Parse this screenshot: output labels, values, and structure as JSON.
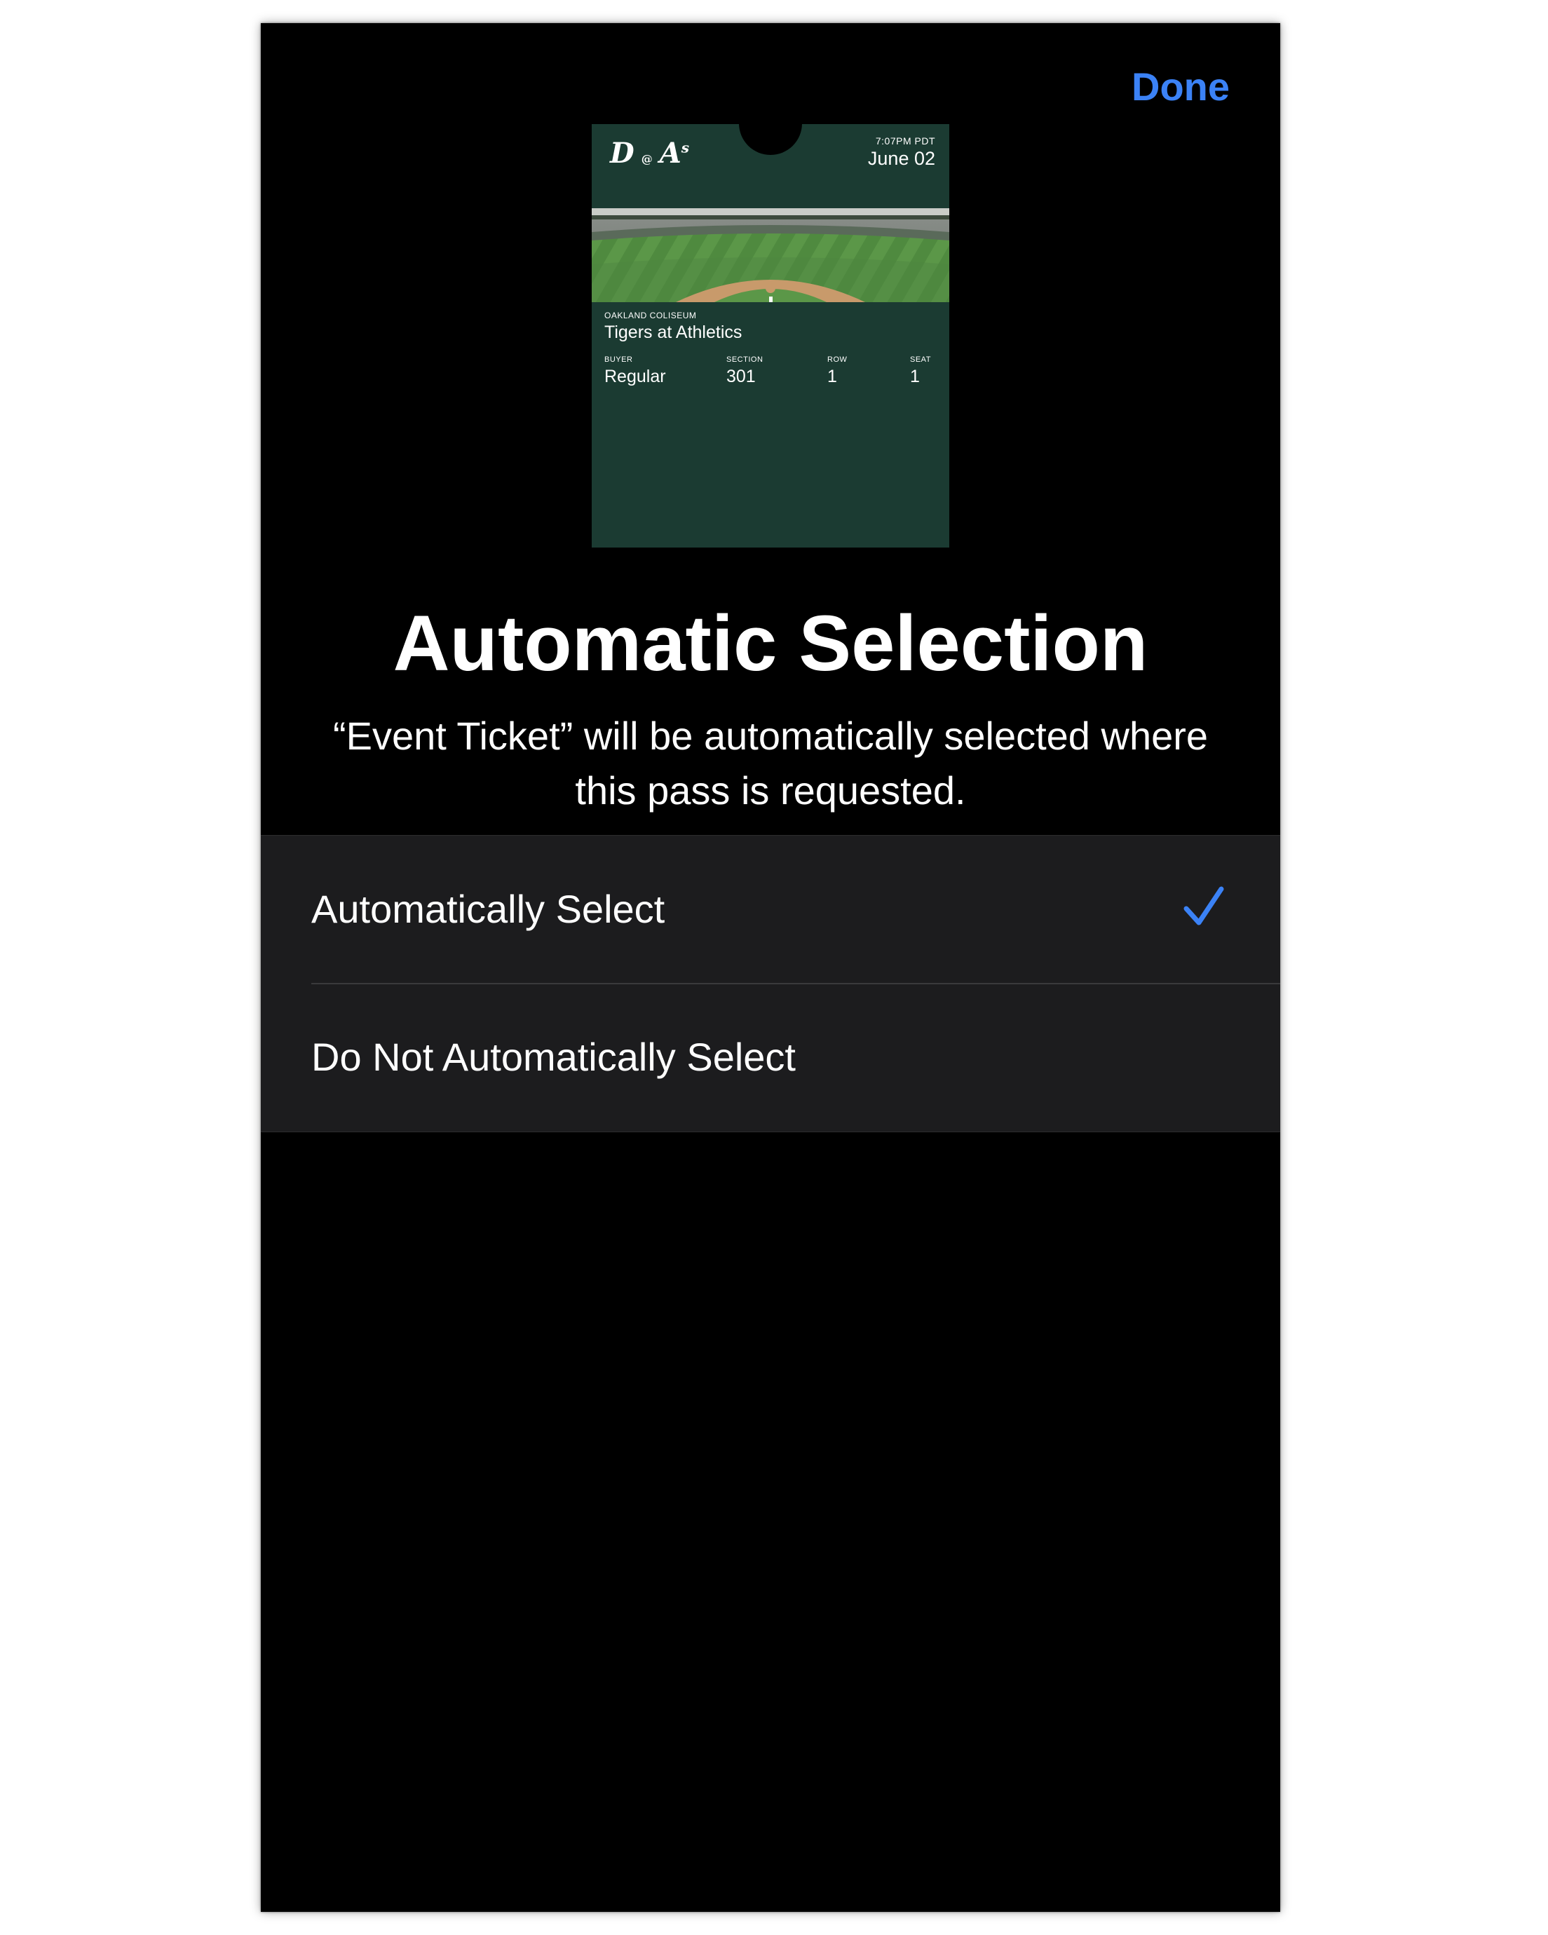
{
  "toolbar": {
    "done_label": "Done"
  },
  "pass": {
    "team_home_logo": "D",
    "at_symbol": "@",
    "team_away_logo": "A",
    "team_away_logo_suffix": "s",
    "time": "7:07PM PDT",
    "date": "June 02",
    "venue": "OAKLAND COLISEUM",
    "event": "Tigers at Athletics",
    "fields": [
      {
        "label": "BUYER",
        "value": "Regular"
      },
      {
        "label": "SECTION",
        "value": "301"
      },
      {
        "label": "ROW",
        "value": "1"
      },
      {
        "label": "SEAT",
        "value": "1"
      }
    ]
  },
  "header": {
    "title": "Automatic Selection",
    "subtitle": "“Event Ticket” will be automatically selected where this pass is requested."
  },
  "options": [
    {
      "label": "Automatically Select",
      "selected": true
    },
    {
      "label": "Do Not Automatically Select",
      "selected": false
    }
  ],
  "colors": {
    "accent": "#3b82f6",
    "pass_background": "#1b3b32",
    "list_background": "#1c1c1e"
  },
  "icons": {
    "selected": "checkmark-icon"
  }
}
